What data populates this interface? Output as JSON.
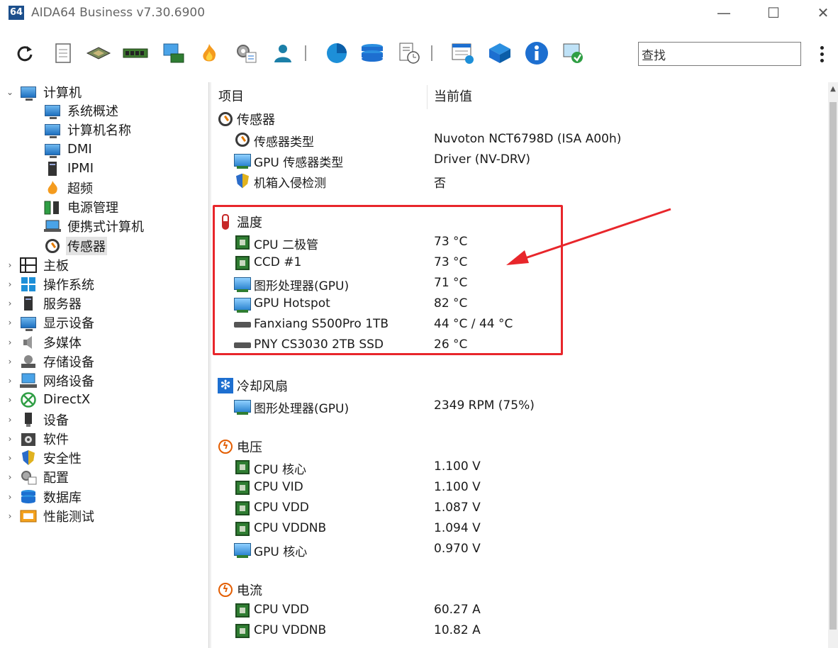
{
  "window": {
    "logo_text": "64",
    "title": "AIDA64 Business v7.30.6900",
    "minimize_glyph": "—",
    "maximize_glyph": "☐",
    "close_glyph": "✕"
  },
  "toolbar": {
    "icons": [
      "refresh-icon",
      "report-icon",
      "cpu-icon",
      "memory-icon",
      "motherboard-icon",
      "overclock-icon",
      "config-icon",
      "user-icon",
      "disk-icon",
      "database-icon",
      "benchmark-icon",
      "network-icon",
      "directx-icon",
      "info-icon",
      "remote-icon"
    ],
    "search_value": "查找"
  },
  "tree": {
    "root": {
      "label": "计算机",
      "expanded": true
    },
    "children": [
      {
        "label": "系统概述",
        "icon": "monitor-icon"
      },
      {
        "label": "计算机名称",
        "icon": "monitor-icon"
      },
      {
        "label": "DMI",
        "icon": "monitor-icon"
      },
      {
        "label": "IPMI",
        "icon": "server-icon"
      },
      {
        "label": "超频",
        "icon": "flame-icon"
      },
      {
        "label": "电源管理",
        "icon": "battery-icon"
      },
      {
        "label": "便携式计算机",
        "icon": "laptop-icon"
      },
      {
        "label": "传感器",
        "icon": "sensor-icon",
        "selected": true
      }
    ],
    "top_level": [
      {
        "label": "主板",
        "icon": "motherboard-icon"
      },
      {
        "label": "操作系统",
        "icon": "windows-icon"
      },
      {
        "label": "服务器",
        "icon": "server-icon"
      },
      {
        "label": "显示设备",
        "icon": "display-icon"
      },
      {
        "label": "多媒体",
        "icon": "speaker-icon"
      },
      {
        "label": "存储设备",
        "icon": "storage-icon"
      },
      {
        "label": "网络设备",
        "icon": "network-icon"
      },
      {
        "label": "DirectX",
        "icon": "xbox-icon"
      },
      {
        "label": "设备",
        "icon": "device-icon"
      },
      {
        "label": "软件",
        "icon": "software-icon"
      },
      {
        "label": "安全性",
        "icon": "shield-icon"
      },
      {
        "label": "配置",
        "icon": "config-icon"
      },
      {
        "label": "数据库",
        "icon": "database-icon"
      },
      {
        "label": "性能测试",
        "icon": "benchmark-icon"
      }
    ]
  },
  "content": {
    "columns": {
      "item": "项目",
      "value": "当前值"
    },
    "sections": [
      {
        "title": "传感器",
        "icon": "sensor-icon",
        "rows": [
          {
            "label": "传感器类型",
            "value": "Nuvoton NCT6798D  (ISA A00h)",
            "icon": "sensor-icon"
          },
          {
            "label": "GPU 传感器类型",
            "value": "Driver  (NV-DRV)",
            "icon": "gpu-icon"
          },
          {
            "label": "机箱入侵检测",
            "value": "否",
            "icon": "shield-icon"
          }
        ]
      },
      {
        "title": "温度",
        "icon": "thermometer-icon",
        "rows": [
          {
            "label": "CPU 二极管",
            "value": "73 °C",
            "icon": "chip-icon"
          },
          {
            "label": "CCD #1",
            "value": "73 °C",
            "icon": "chip-icon"
          },
          {
            "label": "图形处理器(GPU)",
            "value": "71 °C",
            "icon": "gpu-icon"
          },
          {
            "label": "GPU Hotspot",
            "value": "82 °C",
            "icon": "gpu-icon"
          },
          {
            "label": "Fanxiang S500Pro 1TB",
            "value": "44 °C / 44 °C",
            "icon": "drive-icon"
          },
          {
            "label": "PNY CS3030 2TB SSD",
            "value": "26 °C",
            "icon": "drive-icon"
          }
        ]
      },
      {
        "title": "冷却风扇",
        "icon": "fan-icon",
        "rows": [
          {
            "label": "图形处理器(GPU)",
            "value": "2349 RPM  (75%)",
            "icon": "gpu-icon"
          }
        ]
      },
      {
        "title": "电压",
        "icon": "voltage-icon",
        "rows": [
          {
            "label": "CPU 核心",
            "value": "1.100 V",
            "icon": "chip-icon"
          },
          {
            "label": "CPU VID",
            "value": "1.100 V",
            "icon": "chip-icon"
          },
          {
            "label": "CPU VDD",
            "value": "1.087 V",
            "icon": "chip-icon"
          },
          {
            "label": "CPU VDDNB",
            "value": "1.094 V",
            "icon": "chip-icon"
          },
          {
            "label": "GPU 核心",
            "value": "0.970 V",
            "icon": "gpu-icon"
          }
        ]
      },
      {
        "title": "电流",
        "icon": "current-icon",
        "rows": [
          {
            "label": "CPU VDD",
            "value": "60.27 A",
            "icon": "chip-icon"
          },
          {
            "label": "CPU VDDNB",
            "value": "10.82 A",
            "icon": "chip-icon"
          }
        ]
      }
    ]
  },
  "colors": {
    "highlight_box": "#e8262b",
    "selected_bg": "#e3e3e3"
  }
}
